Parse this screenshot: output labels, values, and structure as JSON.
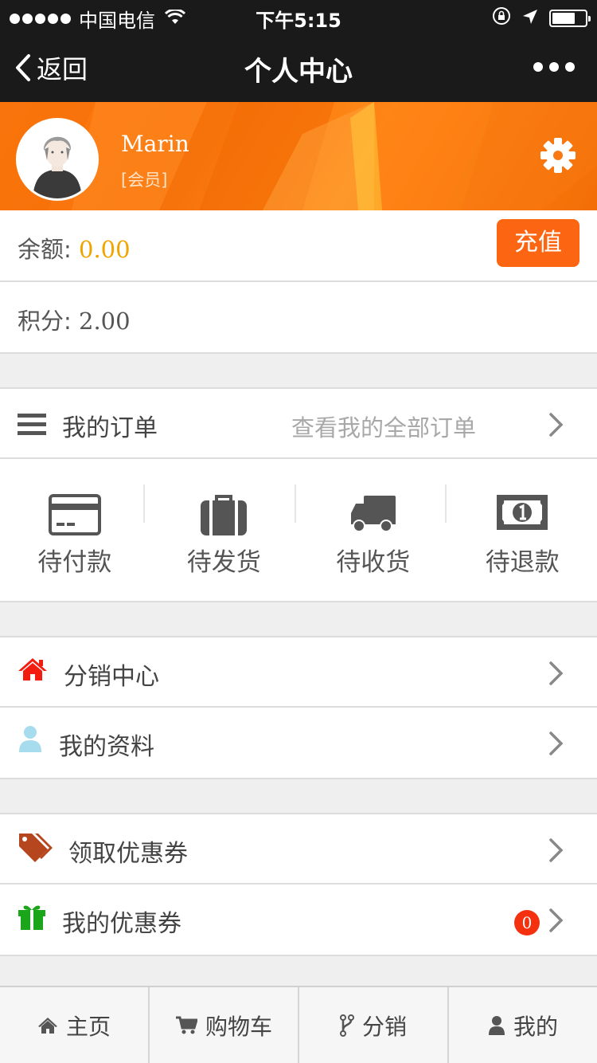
{
  "status_bar": {
    "carrier": "中国电信",
    "time": "下午5:15"
  },
  "nav": {
    "back_label": "返回",
    "title": "个人中心"
  },
  "profile": {
    "name": "Marin",
    "level": "[会员]"
  },
  "balance": {
    "label": "余额: ",
    "value": "0.00",
    "recharge_label": "充值"
  },
  "points": {
    "label": "积分: ",
    "value": "2.00"
  },
  "orders": {
    "title": "我的订单",
    "view_all": "查看我的全部订单",
    "statuses": [
      {
        "label": "待付款",
        "icon": "credit-card-icon"
      },
      {
        "label": "待发货",
        "icon": "briefcase-icon"
      },
      {
        "label": "待收货",
        "icon": "truck-icon"
      },
      {
        "label": "待退款",
        "icon": "money-icon"
      }
    ]
  },
  "menu": {
    "distribution_center": "分销中心",
    "my_profile": "我的资料",
    "get_coupons": "领取优惠券",
    "my_coupons": "我的优惠券",
    "my_coupons_count": "0"
  },
  "tabs": [
    {
      "label": "主页",
      "icon": "home-icon"
    },
    {
      "label": "购物车",
      "icon": "cart-icon"
    },
    {
      "label": "分销",
      "icon": "branch-icon"
    },
    {
      "label": "我的",
      "icon": "user-icon"
    }
  ],
  "colors": {
    "accent": "#fc6612",
    "balance": "#f0a400",
    "badge": "#f4300f",
    "header_bg": "#1a1a1a"
  }
}
